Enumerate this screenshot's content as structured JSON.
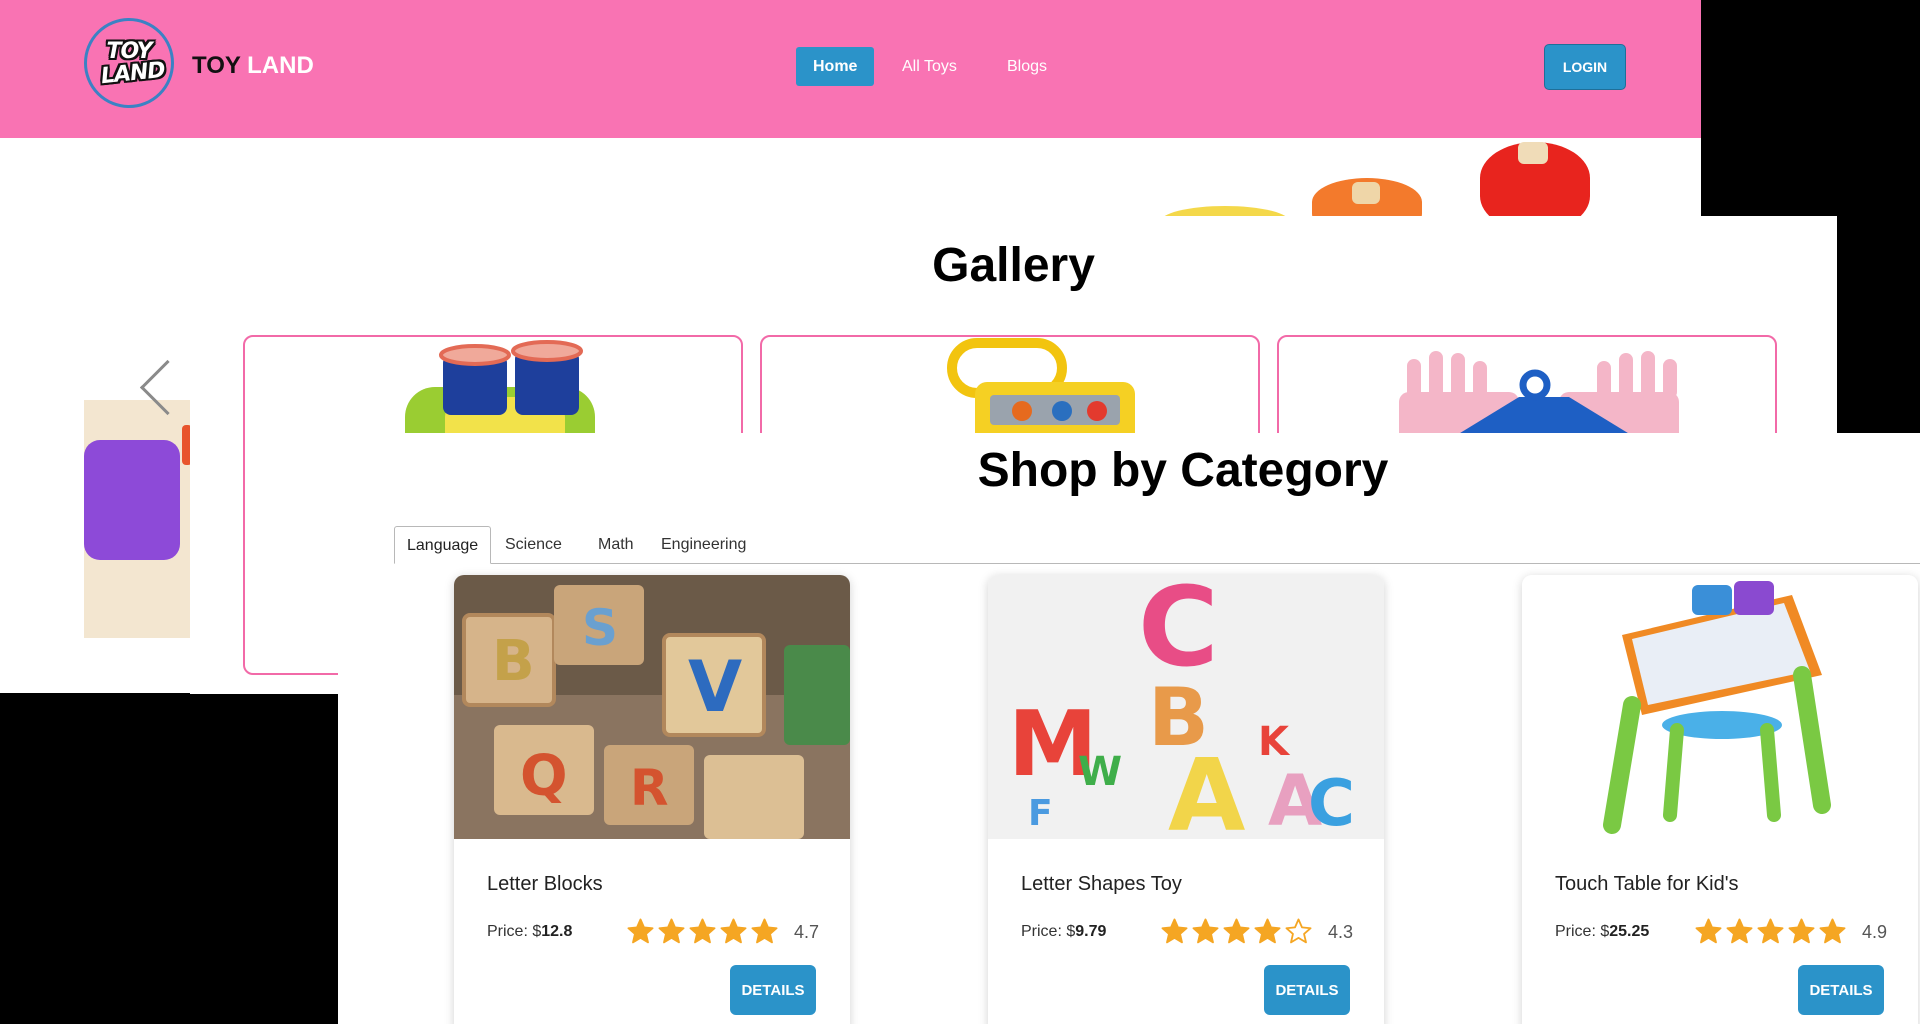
{
  "brand": {
    "logo_line1": "TOY",
    "logo_line2": "LAND",
    "name_part1": "TOY",
    "name_part2": "LAND"
  },
  "nav": {
    "links": [
      {
        "label": "Home",
        "active": true
      },
      {
        "label": "All Toys",
        "active": false
      },
      {
        "label": "Blogs",
        "active": false
      }
    ],
    "login_label": "LOGIN"
  },
  "gallery": {
    "title": "Gallery"
  },
  "shop": {
    "title": "Shop by Category",
    "tabs": [
      {
        "label": "Language",
        "active": true
      },
      {
        "label": "Science",
        "active": false
      },
      {
        "label": "Math",
        "active": false
      },
      {
        "label": "Engineering",
        "active": false
      }
    ],
    "products": [
      {
        "name": "Letter Blocks",
        "price_label": "Price: $",
        "price": "12.8",
        "rating": "4.7",
        "stars_full": 5,
        "details_label": "DETAILS"
      },
      {
        "name": "Letter Shapes Toy",
        "price_label": "Price: $",
        "price": "9.79",
        "rating": "4.3",
        "stars_full": 4,
        "details_label": "DETAILS"
      },
      {
        "name": "Touch Table for Kid's",
        "price_label": "Price: $",
        "price": "25.25",
        "rating": "4.9",
        "stars_full": 5,
        "details_label": "DETAILS"
      }
    ]
  },
  "colors": {
    "navbar": "#f973b3",
    "accent_blue": "#2b93c9",
    "gallery_border": "#f26aa8",
    "star": "#f5a623"
  }
}
